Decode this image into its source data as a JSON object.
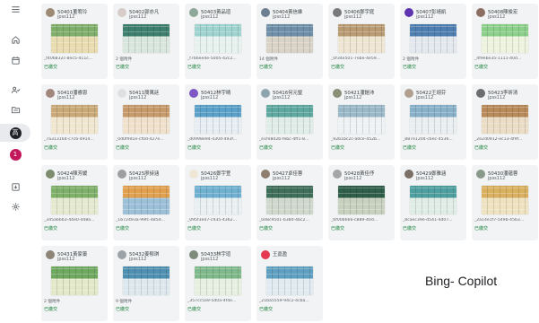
{
  "sidebar": {
    "menu_icon": "menu-icon",
    "home_icon": "home-icon",
    "calendar_icon": "calendar-icon",
    "people_icon": "people-icon",
    "assignments_icon": "folder-icon",
    "class_avatar_1": {
      "letter": "高",
      "color": "#202124"
    },
    "class_avatar_2": {
      "letter": "1",
      "color": "#c2185b"
    },
    "archive_icon": "archive-icon",
    "settings_icon": "gear-icon"
  },
  "colors": {
    "card_bg": "#f1f3f4",
    "status_green": "#188038",
    "text_gray": "#5f6368"
  },
  "submissions": [
    {
      "name": "50401董宥玲",
      "subtitle": "jpss112",
      "avatar_color": "#9b8a74",
      "thumb": [
        "#7fae6a",
        "#e9dcb0"
      ],
      "file": "_f406832c-8ec5-411c...",
      "status": "已繳交"
    },
    {
      "name": "50402郭亦凡",
      "subtitle": "jpss112",
      "avatar_color": "#d7ccc8",
      "thumb": [
        "#3f7f6e",
        "#d8e6de"
      ],
      "file": "2 個附件",
      "status": "已繳交"
    },
    {
      "name": "50403黃品瑄",
      "subtitle": "jpss112",
      "avatar_color": "#8fa89a",
      "thumb": [
        "#9fd3cf",
        "#e7f2ef"
      ],
      "file": "_f7b6ee4e-5005-42c2...",
      "status": "已繳交"
    },
    {
      "name": "50404黃信維",
      "subtitle": "jpss112",
      "avatar_color": "#6d7f91",
      "thumb": [
        "#6f8fa8",
        "#d9d3c7"
      ],
      "file": "14 個附件",
      "status": "已繳交"
    },
    {
      "name": "50406鄭宇庭",
      "subtitle": "jpss112",
      "avatar_color": "#7a7a7a",
      "thumb": [
        "#b89a73",
        "#efe5d3"
      ],
      "file": "_0f34e501-7ebe-4e59...",
      "status": "已繳交"
    },
    {
      "name": "50407彭靖凱",
      "subtitle": "jpss112",
      "avatar_color": "#5e35b1",
      "thumb": [
        "#4f7fb0",
        "#e3e8ef"
      ],
      "file": "2 個附件",
      "status": "已繳交"
    },
    {
      "name": "50408陳俊宏",
      "subtitle": "jpss112",
      "avatar_color": "#8d6e63",
      "thumb": [
        "#8ccf8a",
        "#eef3df"
      ],
      "file": "_4f9ebe35-1111-40d...",
      "status": "已繳交"
    },
    {
      "name": "50410潘睿恩",
      "subtitle": "jpss112",
      "avatar_color": "#a1887f",
      "thumb": [
        "#c9a978",
        "#f1e6cf"
      ],
      "file": "_7a313164-c7c6-4914...",
      "status": "已繳交"
    },
    {
      "name": "50411簡萬廷",
      "subtitle": "jpss112",
      "avatar_color": "#e0e0e0",
      "thumb": [
        "#c79a6b",
        "#efe1cc"
      ],
      "file": "_0d0f9d1e-cf0d-427e...",
      "status": "已繳交"
    },
    {
      "name": "50412林宇晴",
      "subtitle": "jpss112",
      "avatar_color": "#7e57c2",
      "thumb": [
        "#5aa0c8",
        "#e6eef3"
      ],
      "file": "_d0998e94-430d-493f...",
      "status": "已繳交"
    },
    {
      "name": "50416何元聖",
      "subtitle": "jpss112",
      "avatar_color": "#90a4ae",
      "thumb": [
        "#5fa8a0",
        "#dfece8"
      ],
      "file": "_e1fe8d2b-febc-4ff1-8...",
      "status": "已繳交"
    },
    {
      "name": "50421潘鎧沛",
      "subtitle": "jpss112",
      "avatar_color": "#8a8f7a",
      "thumb": [
        "#9ab8c8",
        "#eef2f4"
      ],
      "file": "_92b1bc2c-a0ce-452b...",
      "status": "已繳交"
    },
    {
      "name": "50422王翊芬",
      "subtitle": "jpss112",
      "avatar_color": "#b0a090",
      "thumb": [
        "#88b0c8",
        "#e9eef0"
      ],
      "file": "_887e1204-c6ec-4536...",
      "status": "已繳交"
    },
    {
      "name": "50423李昕清",
      "subtitle": "jpss112",
      "avatar_color": "#6d6d6d",
      "thumb": [
        "#b88a5a",
        "#eadcc5"
      ],
      "file": "_2e2d0912-ec13-4f9f...",
      "status": "已繳交"
    },
    {
      "name": "50424陳芳媛",
      "subtitle": "jpss112",
      "avatar_color": "#7c8c6c",
      "thumb": [
        "#7fb06a",
        "#e4e9cf"
      ],
      "file": "_345a66b3-44e0-448a...",
      "status": "已繳交"
    },
    {
      "name": "50425廖詩涵",
      "subtitle": "jpss112",
      "avatar_color": "#9e9e9e",
      "thumb": [
        "#e0a050",
        "#9cc0d8"
      ],
      "file": "_1b72493a-99fc-485d...",
      "status": "已繳交"
    },
    {
      "name": "50426鄭宇萱",
      "subtitle": "jpss112",
      "avatar_color": "#efe6d8",
      "thumb": [
        "#6fb0d0",
        "#e8f0f2"
      ],
      "file": "_095f3e47-c935-4362...",
      "status": "已繳交"
    },
    {
      "name": "50427卓佳蓉",
      "subtitle": "jpss112",
      "avatar_color": "#8d7e70",
      "thumb": [
        "#3f6f5a",
        "#cfd8cc"
      ],
      "file": "_0e8c9501-b380-4bc2...",
      "status": "已繳交"
    },
    {
      "name": "50428黃佳伃",
      "subtitle": "jpss112",
      "avatar_color": "#a5a5a5",
      "thumb": [
        "#2f5f4a",
        "#c8d0c0"
      ],
      "file": "_6f00b666-c889-40d...",
      "status": "已繳交"
    },
    {
      "name": "50429鄭雅涵",
      "subtitle": "jpss112",
      "avatar_color": "#7b6f66",
      "thumb": [
        "#4f9fa0",
        "#e0ece6"
      ],
      "file": "_8caec39e-d541-4d07...",
      "status": "已繳交"
    },
    {
      "name": "50430潘蘊蓉",
      "subtitle": "jpss112",
      "avatar_color": "#8a9a8a",
      "thumb": [
        "#d8b060",
        "#eee2c0"
      ],
      "file": "_2a14e1f7-549b-4563...",
      "status": "已繳交"
    },
    {
      "name": "50431黃家蓁",
      "subtitle": "jpss112",
      "avatar_color": "#8f8577",
      "thumb": [
        "#6fa860",
        "#e2e8c8"
      ],
      "file": "2 個附件",
      "status": "已繳交"
    },
    {
      "name": "50432姜郁琪",
      "subtitle": "jpss112",
      "avatar_color": "#9ca3a8",
      "thumb": [
        "#4f8fb0",
        "#dde8ee"
      ],
      "file": "9 個附件",
      "status": "已繳交"
    },
    {
      "name": "50433林宇瑄",
      "subtitle": "jpss112",
      "avatar_color": "#7d8b7d",
      "thumb": [
        "#7fb88a",
        "#e6efe0"
      ],
      "file": "_357cc5a9-5d0a-4f4e...",
      "status": "已繳交"
    },
    {
      "name": "王嘉盈",
      "subtitle": "",
      "avatar_color": "#e53950",
      "thumb": [
        "#5f9fc0",
        "#e0eaf0"
      ],
      "file": "_21ba5559-94c2-4cba...",
      "status": "已繳交"
    }
  ],
  "watermark": "Bing- Copilot"
}
